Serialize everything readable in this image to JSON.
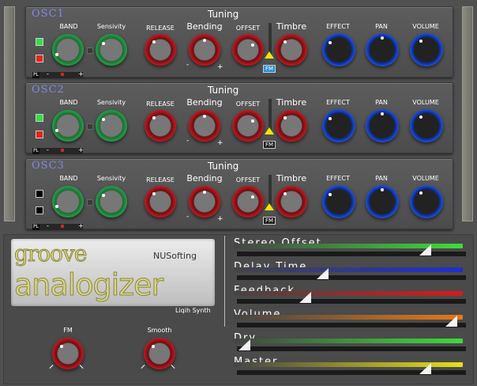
{
  "labels": {
    "tuning": "Tuning",
    "band": "BAND",
    "sensivity": "Sensivity",
    "release": "RELEASE",
    "bending": "Bending",
    "offset": "OFFSET",
    "timbre": "Timbre",
    "effect": "EFFECT",
    "pan": "PAN",
    "volume": "VOLUME",
    "minus": "-",
    "plus": "+",
    "pl": "PL",
    "fm": "FM"
  },
  "oscillators": [
    {
      "name": "OSC1",
      "top_square": "green",
      "bottom_square": "red",
      "fm_active": true
    },
    {
      "name": "OSC2",
      "top_square": "green",
      "bottom_square": "red",
      "fm_active": false
    },
    {
      "name": "OSC3",
      "top_square": "black",
      "bottom_square": "black",
      "fm_active": false
    }
  ],
  "logo": {
    "groove": "groove",
    "analogizer": "analogizer",
    "brand": "NUSofting",
    "subtitle": "Liqih Synth"
  },
  "bottom_knobs": {
    "fm": "FM",
    "smooth": "Smooth"
  },
  "sliders": [
    {
      "name": "Stereo Offset",
      "value": 0.85,
      "color": "#3ddc3a"
    },
    {
      "name": "Delay Time",
      "value": 0.38,
      "color": "#1e2fd0"
    },
    {
      "name": "Feedback",
      "value": 0.3,
      "color": "#d41c1c"
    },
    {
      "name": "Volume",
      "value": 0.97,
      "color": "#e67a16"
    },
    {
      "name": "Dry",
      "value": 0.02,
      "color": "#3ddc3a"
    },
    {
      "name": "Master",
      "value": 0.85,
      "color": "#e6e016"
    }
  ],
  "colors": {
    "osc_name": "#7f87e6",
    "knob_green": "#24a04a",
    "knob_red": "#c2191f",
    "knob_blue": "#1f56e6",
    "fm_active": "#2a8fd6"
  }
}
